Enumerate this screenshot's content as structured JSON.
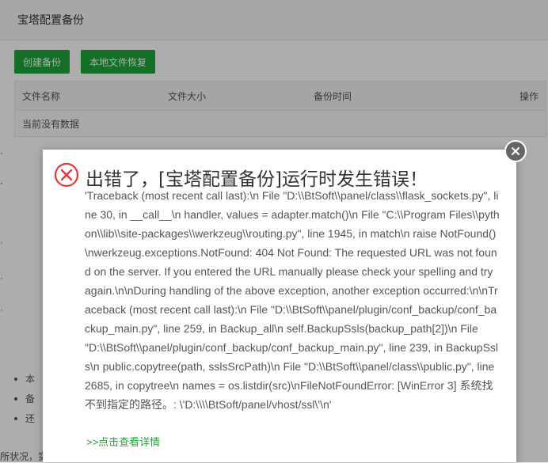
{
  "panel": {
    "title": "宝塔配置备份",
    "buttons": {
      "create_backup": "创建备份",
      "local_restore": "本地文件恢复"
    },
    "table": {
      "columns": [
        "文件名称",
        "文件大小",
        "备份时间",
        "操作"
      ],
      "empty_text": "当前没有数据"
    },
    "bullets": [
      "本",
      "备",
      "还"
    ],
    "bottom_fragment": "所状况，实"
  },
  "dialog": {
    "icon": "error-circle-x-icon",
    "title": "出错了，[宝塔配置备份]运行时发生错误！",
    "message": "'Traceback (most recent call last):\\n File \"D:\\\\BtSoft\\\\panel/class\\\\flask_sockets.py\", line 30, in __call__\\n handler, values = adapter.match()\\n File \"C:\\\\Program Files\\\\python\\\\lib\\\\site-packages\\\\werkzeug\\\\routing.py\", line 1945, in match\\n raise NotFound()\\nwerkzeug.exceptions.NotFound: 404 Not Found: The requested URL was not found on the server. If you entered the URL manually please check your spelling and try again.\\n\\nDuring handling of the above exception, another exception occurred:\\n\\nTraceback (most recent call last):\\n File \"D:\\\\BtSoft\\\\panel/plugin/conf_backup/conf_backup_main.py\", line 259, in Backup_all\\n self.BackupSsls(backup_path[2])\\n File \"D:\\\\BtSoft\\\\panel/plugin/conf_backup/conf_backup_main.py\", line 239, in BackupSsls\\n public.copytree(path, sslsSrcPath)\\n File \"D:\\\\BtSoft\\\\panel/class\\\\public.py\", line 2685, in copytree\\n names = os.listdir(src)\\nFileNotFoundError: [WinError 3] 系统找不到指定的路径。: \\'D:\\\\\\\\BtSoft/panel/vhost/ssl\\'\\n'",
    "details_link": ">>点击查看详情",
    "close_icon": "close-icon"
  },
  "colors": {
    "accent_green": "#20a53a",
    "error_red": "#e4393c",
    "close_bg": "#666666"
  }
}
